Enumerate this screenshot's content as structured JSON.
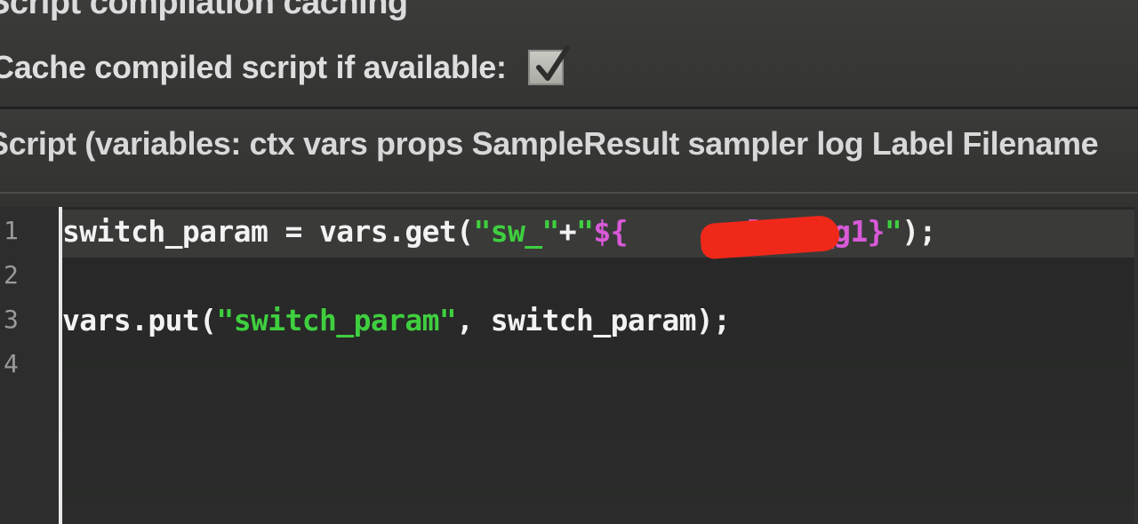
{
  "caching": {
    "group_title": "Script compilation caching",
    "cache_label": "Cache compiled script if available:",
    "cache_checked": true,
    "checkbox_icon": "checkmark-icon"
  },
  "script": {
    "label": "Script (variables: ctx vars props SampleResult sampler log Label Filename"
  },
  "editor": {
    "line_numbers": [
      "1",
      "2",
      "3",
      "4"
    ],
    "lines": [
      {
        "tokens": [
          {
            "text": "switch_param = vars.get(",
            "type": "plain"
          },
          {
            "text": "\"sw_\"",
            "type": "str"
          },
          {
            "text": "+",
            "type": "plain"
          },
          {
            "text": "\"",
            "type": "str"
          },
          {
            "text": "${",
            "type": "var"
          },
          {
            "text": "       ",
            "type": "plain"
          },
          {
            "text": "le_1_g1}",
            "type": "var"
          },
          {
            "text": "\"",
            "type": "str"
          },
          {
            "text": ");",
            "type": "plain"
          }
        ]
      },
      {
        "tokens": []
      },
      {
        "tokens": [
          {
            "text": "vars.put(",
            "type": "plain"
          },
          {
            "text": "\"switch_param\"",
            "type": "str"
          },
          {
            "text": ", switch_param);",
            "type": "plain"
          }
        ]
      },
      {
        "tokens": []
      }
    ],
    "colors": {
      "string": "#3fcf3f",
      "variable": "#d95ad8",
      "redaction": "#f0281a"
    }
  }
}
